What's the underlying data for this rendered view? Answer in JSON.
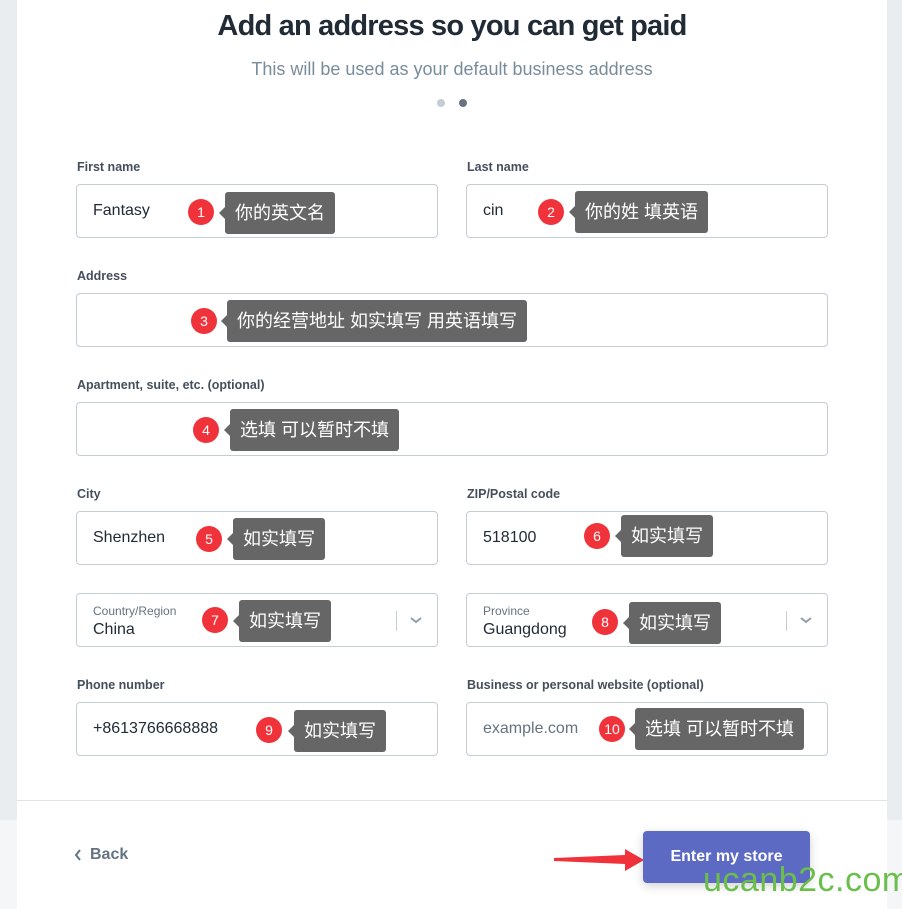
{
  "header": {
    "title": "Add an address so you can get paid",
    "subtitle": "This will be used as your default business address",
    "steps": {
      "total": 2,
      "current": 2
    }
  },
  "fields": {
    "first_name": {
      "label": "First name",
      "value": "Fantasy"
    },
    "last_name": {
      "label": "Last name",
      "value": "cin"
    },
    "address": {
      "label": "Address",
      "value": ""
    },
    "apartment": {
      "label": "Apartment, suite, etc. (optional)",
      "value": ""
    },
    "city": {
      "label": "City",
      "value": "Shenzhen"
    },
    "zip": {
      "label": "ZIP/Postal code",
      "value": "518100"
    },
    "country": {
      "label": "Country/Region",
      "value": "China"
    },
    "province": {
      "label": "Province",
      "value": "Guangdong"
    },
    "phone": {
      "label": "Phone number",
      "value": "+8613766668888"
    },
    "website": {
      "label": "Business or personal website (optional)",
      "placeholder": "example.com"
    }
  },
  "annotations": [
    {
      "number": "1",
      "text": "你的英文名"
    },
    {
      "number": "2",
      "text": "你的姓 填英语"
    },
    {
      "number": "3",
      "text": "你的经营地址 如实填写  用英语填写"
    },
    {
      "number": "4",
      "text": "选填  可以暂时不填"
    },
    {
      "number": "5",
      "text": "如实填写"
    },
    {
      "number": "6",
      "text": "如实填写"
    },
    {
      "number": "7",
      "text": "如实填写"
    },
    {
      "number": "8",
      "text": "如实填写"
    },
    {
      "number": "9",
      "text": "如实填写"
    },
    {
      "number": "10",
      "text": "选填  可以暂时不填"
    }
  ],
  "footer": {
    "back_label": "Back",
    "submit_label": "Enter my store"
  },
  "watermark": "ucanb2c.com",
  "colors": {
    "primary": "#5c6ac4",
    "badge": "#f0333a",
    "tooltip": "#666666",
    "watermark": "#6abf4b"
  }
}
